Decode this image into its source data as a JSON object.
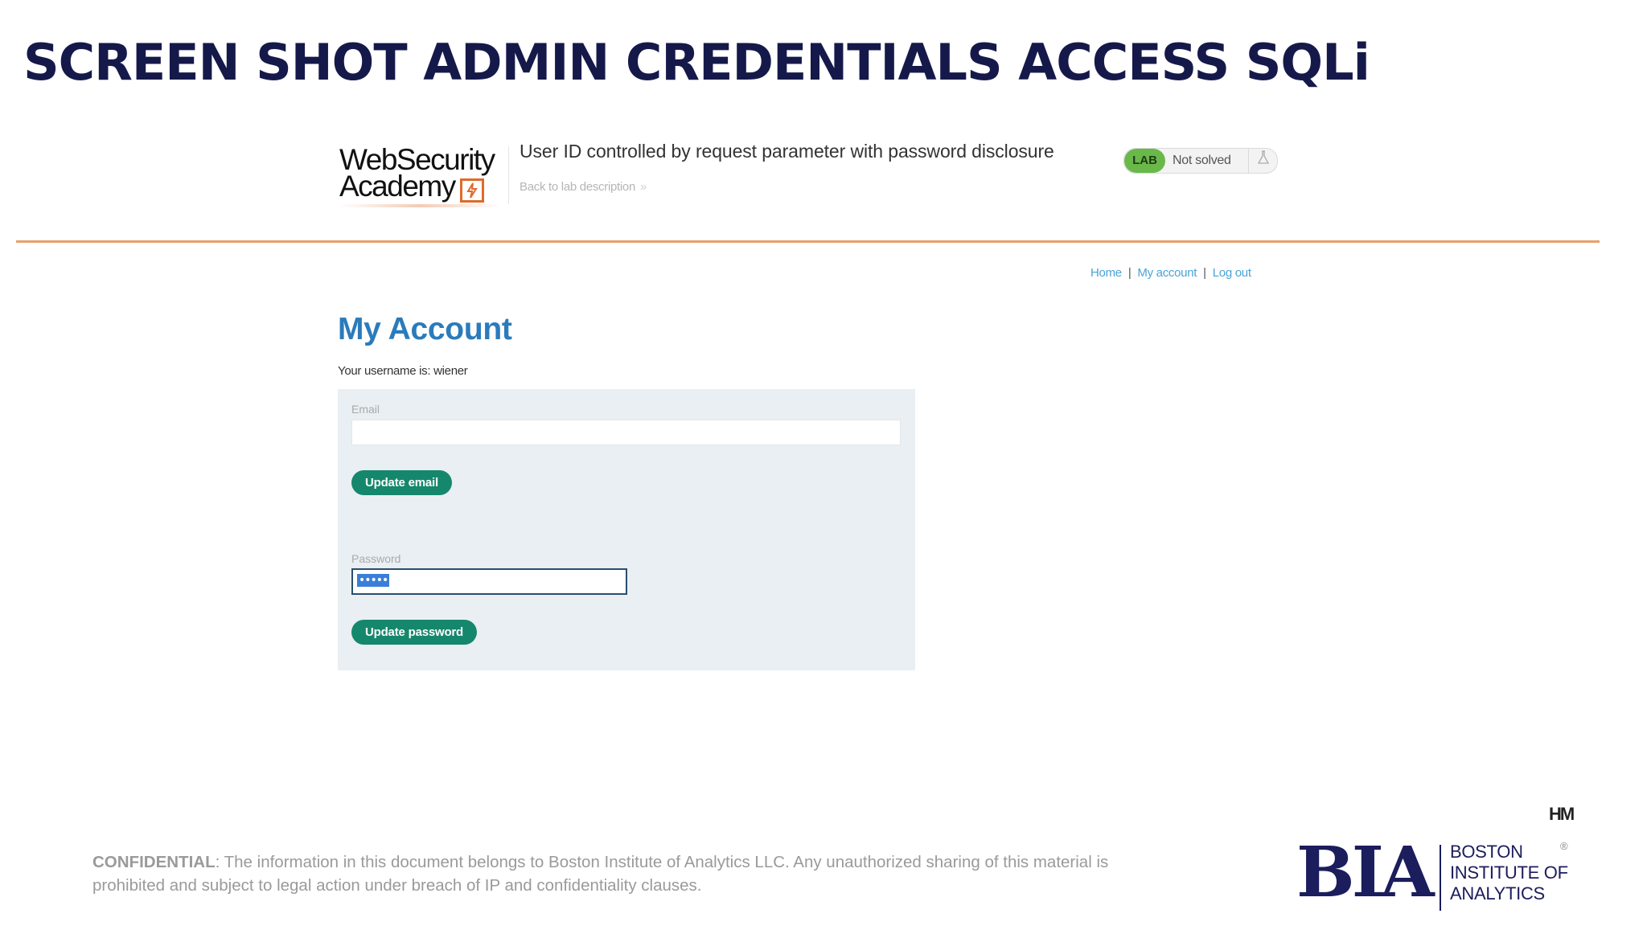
{
  "slide": {
    "title": "SCREEN SHOT ADMIN CREDENTIALS ACCESS SQLi"
  },
  "lab_header": {
    "logo_line1": "WebSecurity",
    "logo_line2": "Academy",
    "lab_title": "User ID controlled by request parameter with password disclosure",
    "back_link": "Back to lab description",
    "back_chevron": "»",
    "badge_label": "LAB",
    "status": "Not solved",
    "flask_icon": "flask-icon",
    "accent_color": "#e06a2a"
  },
  "nav": {
    "home": "Home",
    "separator": "|",
    "my_account": "My account",
    "log_out": "Log out"
  },
  "account": {
    "heading": "My Account",
    "username_line": "Your username is: wiener",
    "email_label": "Email",
    "email_value": "",
    "update_email": "Update email",
    "password_label": "Password",
    "password_value": "•••••",
    "update_password": "Update password",
    "button_color": "#15876d"
  },
  "footer": {
    "confidential_label": "CONFIDENTIAL",
    "confidential_text": ": The information in this document belongs to Boston Institute of Analytics LLC. Any unauthorized sharing of this material is prohibited and subject to legal action under breach of IP and confidentiality clauses.",
    "corner_mark": "HM",
    "bia_letters": "BIA",
    "bia_line1": "BOSTON",
    "bia_line2": "INSTITUTE OF",
    "bia_line3": "ANALYTICS",
    "registered": "®",
    "brand_color": "#1b1d5c"
  }
}
